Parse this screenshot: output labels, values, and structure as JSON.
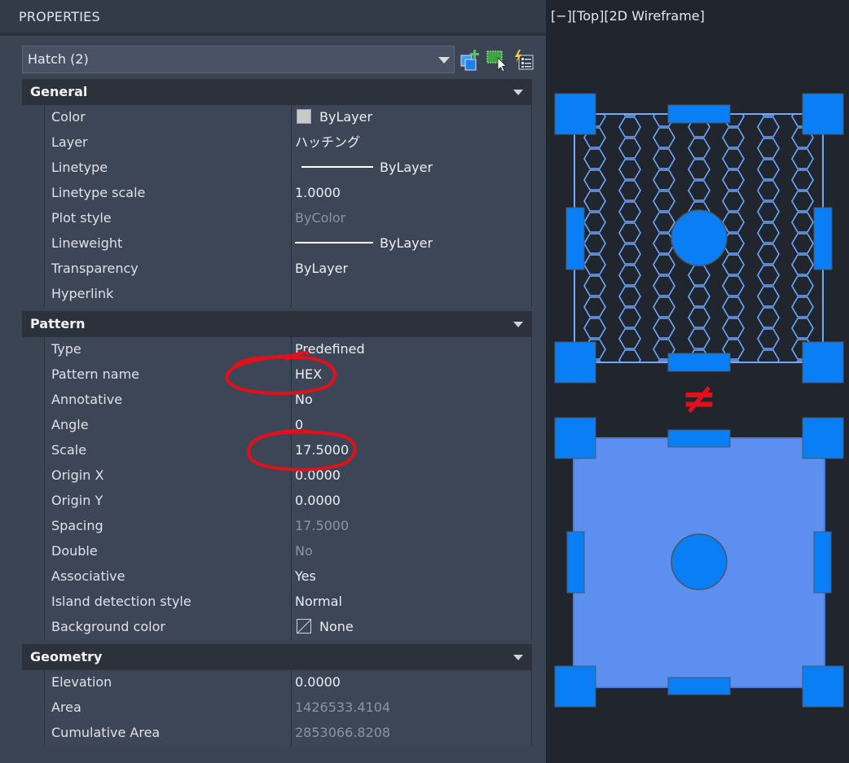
{
  "palette": {
    "title": "PROPERTIES",
    "object_selector": "Hatch (2)",
    "icons": [
      "toggle-pickadd-icon",
      "select-objects-icon",
      "quick-select-icon"
    ]
  },
  "sections": {
    "general": {
      "title": "General",
      "rows": [
        {
          "name": "Color",
          "value": "ByLayer"
        },
        {
          "name": "Layer",
          "value": "ハッチング"
        },
        {
          "name": "Linetype",
          "value": "ByLayer"
        },
        {
          "name": "Linetype scale",
          "value": "1.0000"
        },
        {
          "name": "Plot style",
          "value": "ByColor"
        },
        {
          "name": "Lineweight",
          "value": "ByLayer"
        },
        {
          "name": "Transparency",
          "value": "ByLayer"
        },
        {
          "name": "Hyperlink",
          "value": ""
        }
      ]
    },
    "pattern": {
      "title": "Pattern",
      "rows": [
        {
          "name": "Type",
          "value": "Predefined"
        },
        {
          "name": "Pattern name",
          "value": "HEX"
        },
        {
          "name": "Annotative",
          "value": "No"
        },
        {
          "name": "Angle",
          "value": "0"
        },
        {
          "name": "Scale",
          "value": "17.5000"
        },
        {
          "name": "Origin X",
          "value": "0.0000"
        },
        {
          "name": "Origin Y",
          "value": "0.0000"
        },
        {
          "name": "Spacing",
          "value": "17.5000"
        },
        {
          "name": "Double",
          "value": "No"
        },
        {
          "name": "Associative",
          "value": "Yes"
        },
        {
          "name": "Island detection style",
          "value": "Normal"
        },
        {
          "name": "Background color",
          "value": "None"
        }
      ]
    },
    "geometry": {
      "title": "Geometry",
      "rows": [
        {
          "name": "Elevation",
          "value": "0.0000"
        },
        {
          "name": "Area",
          "value": "1426533.4104"
        },
        {
          "name": "Cumulative Area",
          "value": "2853066.8208"
        }
      ]
    }
  },
  "viewport": {
    "control_minus": "[−]",
    "view_name": "[Top]",
    "visual_style": "[2D Wireframe]",
    "annotation_symbol": "≠"
  },
  "colors": {
    "grip": "#0a7ff5",
    "hatch_line": "#6fa8ff",
    "solid_fill": "#5d8ff0",
    "annotation_red": "#e3101c"
  }
}
